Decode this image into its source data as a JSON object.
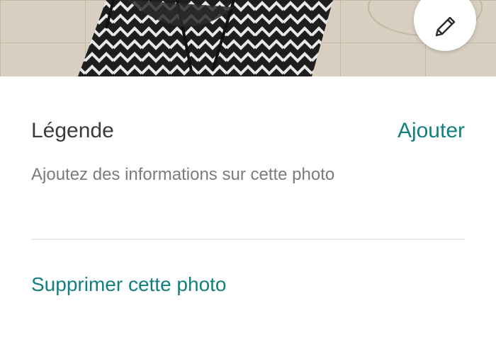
{
  "photo": {
    "icon": "photo-thumbnail"
  },
  "edit_button": {
    "icon": "pencil-icon"
  },
  "caption": {
    "label": "Légende",
    "action": "Ajouter",
    "hint": "Ajoutez des informations sur cette photo"
  },
  "delete": {
    "label": "Supprimer cette photo"
  },
  "colors": {
    "accent": "#128080",
    "label": "#3b3b3b",
    "hint": "#7b7b7b",
    "divider": "#ebebeb"
  }
}
